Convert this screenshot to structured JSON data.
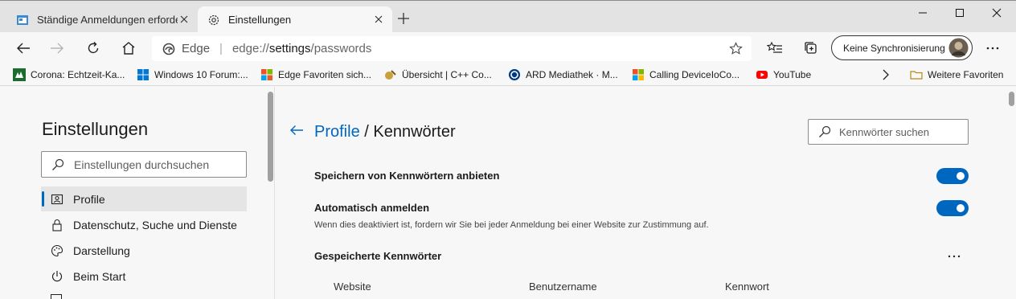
{
  "tabs": [
    {
      "label": "Ständige Anmeldungen erforderlich",
      "icon": "site-favicon"
    },
    {
      "label": "Einstellungen",
      "icon": "gear-icon"
    }
  ],
  "address": {
    "brand": "Edge",
    "url_prefix": "edge://",
    "url_host": "settings",
    "url_path": "/passwords"
  },
  "sync_button": {
    "label": "Keine Synchronisierung"
  },
  "favorites": [
    {
      "label": "Corona: Echtzeit-Ka...",
      "color": "#1a6d2f"
    },
    {
      "label": "Windows 10 Forum:...",
      "color": "#0078d4"
    },
    {
      "label": "Edge Favoriten sich...",
      "color": "#e85c2a"
    },
    {
      "label": "Übersicht | C++ Co...",
      "color": "#c9a03b"
    },
    {
      "label": "ARD Mediathek · M...",
      "color": "#003a80"
    },
    {
      "label": "Calling DeviceIoCo...",
      "color": "#f25022"
    },
    {
      "label": "YouTube",
      "color": "#ff0000"
    }
  ],
  "favorites_more": "Weitere Favoriten",
  "sidebar": {
    "title": "Einstellungen",
    "search_placeholder": "Einstellungen durchsuchen",
    "items": [
      {
        "label": "Profile",
        "icon": "profile-icon"
      },
      {
        "label": "Datenschutz, Suche und Dienste",
        "icon": "lock-icon"
      },
      {
        "label": "Darstellung",
        "icon": "palette-icon"
      },
      {
        "label": "Beim Start",
        "icon": "power-icon"
      }
    ]
  },
  "main": {
    "breadcrumb_parent": "Profile",
    "breadcrumb_separator": " / ",
    "title": "Kennwörter",
    "search_placeholder": "Kennwörter suchen",
    "offer_save_label": "Speichern von Kennwörtern anbieten",
    "offer_save_enabled": true,
    "auto_signin_label": "Automatisch anmelden",
    "auto_signin_desc": "Wenn dies deaktiviert ist, fordern wir Sie bei jeder Anmeldung bei einer Website zur Zustimmung auf.",
    "auto_signin_enabled": true,
    "saved_heading": "Gespeicherte Kennwörter",
    "columns": [
      "Website",
      "Benutzername",
      "Kennwort"
    ]
  },
  "accent_color": "#0067c0"
}
